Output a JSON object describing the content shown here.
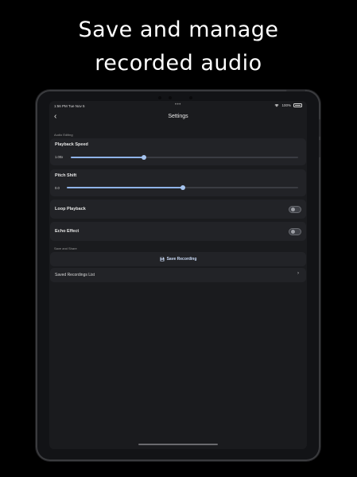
{
  "promo": {
    "line1": "Save and manage",
    "line2": "recorded audio"
  },
  "statusbar": {
    "time": "1:56 PM  Tue Nov 5",
    "dots": "•••",
    "battery_text": "100%",
    "battery_level": 1.0
  },
  "nav": {
    "back_icon": "‹",
    "title": "Settings"
  },
  "audio_editing": {
    "header": "Audio Editing",
    "playback_speed": {
      "label": "Playback Speed",
      "value_text": "1.00x",
      "level": 0.32
    },
    "pitch_shift": {
      "label": "Pitch Shift",
      "value_text": "0.0",
      "level": 0.5
    },
    "loop_playback": {
      "label": "Loop Playback",
      "on": false
    },
    "echo_effect": {
      "label": "Echo Effect",
      "on": false
    }
  },
  "save_share": {
    "header": "Save and Share",
    "save_button": "Save Recording",
    "saved_list": "Saved Recordings List",
    "chevron": "›"
  },
  "colors": {
    "accent": "#8fb3e8",
    "background": "#000000",
    "screen": "#1a1b1e",
    "card": "#222327"
  },
  "icons": [
    "back-chevron-icon",
    "wifi-icon",
    "battery-icon",
    "floppy-disk-icon",
    "chevron-right-icon"
  ]
}
